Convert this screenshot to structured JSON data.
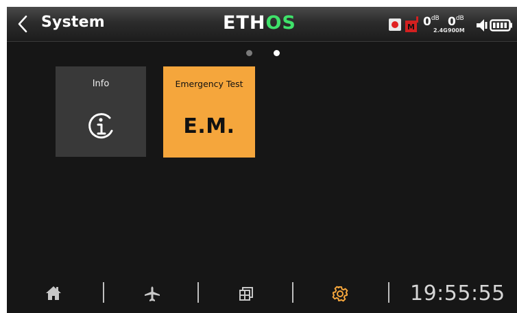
{
  "header": {
    "title": "System",
    "logo_left": "ETH",
    "logo_right": "OS"
  },
  "status": {
    "record_icon": "record-icon",
    "model_badge": "M",
    "rssi_24": {
      "value": "0",
      "unit": "dB",
      "band": "2.4G"
    },
    "rssi_900": {
      "value": "0",
      "unit": "dB",
      "band": "900M"
    },
    "speaker_icon": "speaker-icon",
    "battery_icon": "battery-icon"
  },
  "pager": {
    "pages": 2,
    "current": 2
  },
  "tiles": [
    {
      "label": "Info",
      "icon": "info-icon"
    },
    {
      "label": "Emergency Test",
      "text": "E.M."
    }
  ],
  "nav": {
    "items": [
      "home-icon",
      "airplane-icon",
      "display-icon",
      "gear-icon"
    ],
    "active": "gear-icon",
    "time": "19:55:55"
  },
  "colors": {
    "accent_orange": "#f5a63c",
    "logo_green": "#3fe26a",
    "background": "#161616",
    "tile_gray": "#393939"
  }
}
